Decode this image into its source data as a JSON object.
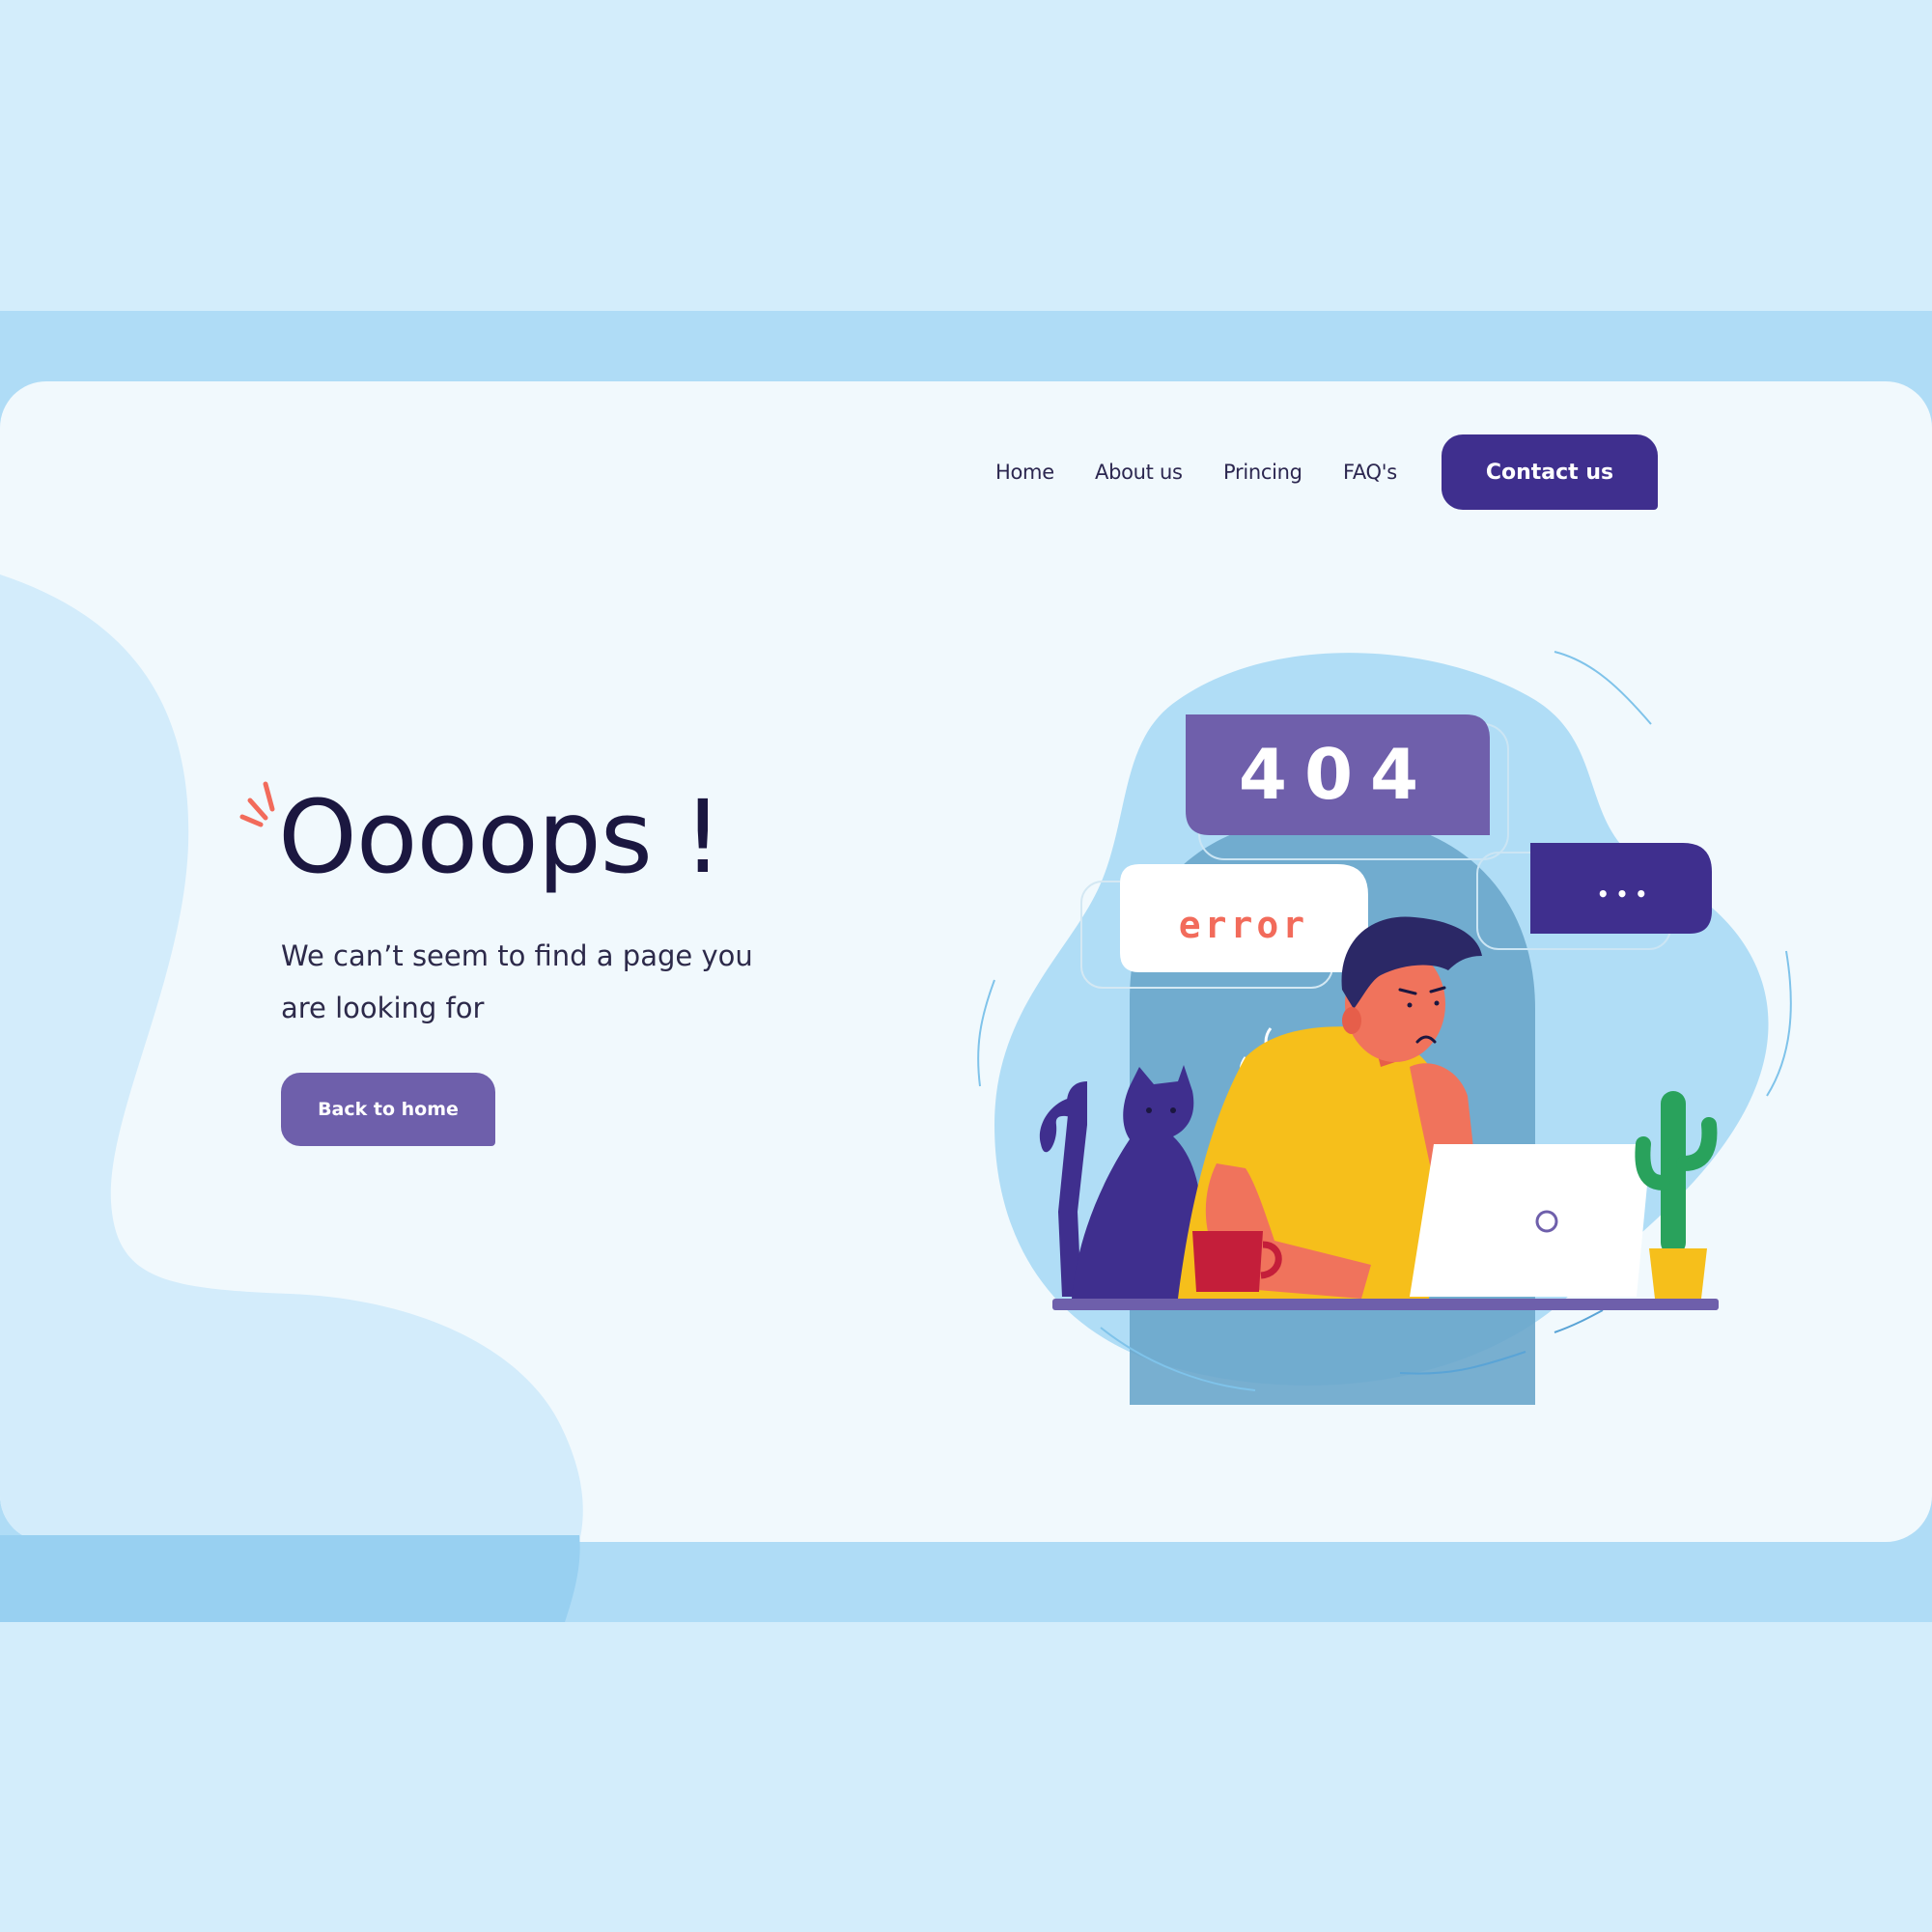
{
  "nav": {
    "items": [
      "Home",
      "About us",
      "Princing",
      "FAQ's"
    ],
    "cta_label": "Contact us"
  },
  "hero": {
    "title": "Oooops !",
    "subtitle": "We can’t seem to find a page you are looking for",
    "button_label": "Back to home"
  },
  "illustration": {
    "code_bubble": "404",
    "error_bubble": "error",
    "typing_bubble": "• • •"
  },
  "colors": {
    "page_bg": "#d3edfb",
    "card_bg": "#f1f9fd",
    "primary": "#3f2f8e",
    "secondary": "#6e5fab",
    "accent": "#f26b5b"
  }
}
